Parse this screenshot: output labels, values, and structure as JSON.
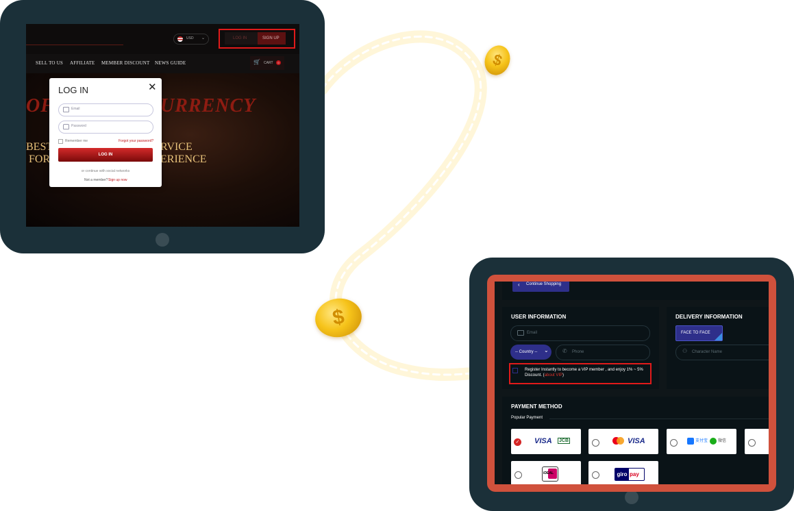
{
  "login_screen": {
    "currency": "USD",
    "currency_flag": "us-flag-icon",
    "header_buttons": {
      "login": "LOG IN",
      "signup": "SIGN UP"
    },
    "nav": [
      "SELL TO US",
      "AFFILIATE",
      "MEMBER DISCOUNT",
      "NEWS GUIDE"
    ],
    "cart": "CART",
    "cart_count": "0",
    "hero": {
      "title_left": "OF",
      "title_right": "URRENCY",
      "line1_left": "BEST",
      "line1_right": "RVICE",
      "line2_left": "FOR",
      "line2_right": "ERIENCE"
    },
    "modal": {
      "title": "LOG IN",
      "email_placeholder": "Email",
      "password_placeholder": "Password",
      "remember": "Remember me",
      "forgot": "Forgot your password?",
      "submit": "LOG IN",
      "social": "or continue with social networks",
      "not_member": "Not a member?",
      "signup_link": "Sign up now"
    }
  },
  "checkout_screen": {
    "continue_shopping": "Continue Shopping",
    "user_info": {
      "title": "USER INFORMATION",
      "email_placeholder": "Email",
      "country": "-- Country --",
      "phone_placeholder": "Phone",
      "vip_text": "Register Instantly to become a VIP member , and enjoy 1% ~ 5% Discount. (",
      "vip_link": "about VIP",
      "vip_close": ")"
    },
    "delivery_info": {
      "title": "DELIVERY INFORMATION",
      "method": "FACE TO FACE",
      "character_placeholder": "Character Name"
    },
    "payment": {
      "title": "PAYMENT METHOD",
      "subtitle": "Popular Payment",
      "options": [
        {
          "name": "visa-jcb",
          "visa": "VISA",
          "jcb": "JCB",
          "selected": true
        },
        {
          "name": "mastercard-visa",
          "visa": "VISA",
          "selected": false
        },
        {
          "name": "alipay-wechat",
          "alipay": "支付宝",
          "wechat": "微信",
          "selected": false
        },
        {
          "name": "more",
          "selected": false
        },
        {
          "name": "ideal",
          "label": "iDEAL",
          "selected": false
        },
        {
          "name": "giropay",
          "giro": "giro",
          "pay": "pay",
          "selected": false
        }
      ]
    }
  },
  "decorations": {
    "coin_symbol": "$"
  },
  "colors": {
    "tablet": "#1b3039",
    "accent_red": "#c0161b",
    "frame_orange": "#d0513c",
    "button_purple": "#2e2f8a",
    "highlight_box": "#e11a1a"
  }
}
